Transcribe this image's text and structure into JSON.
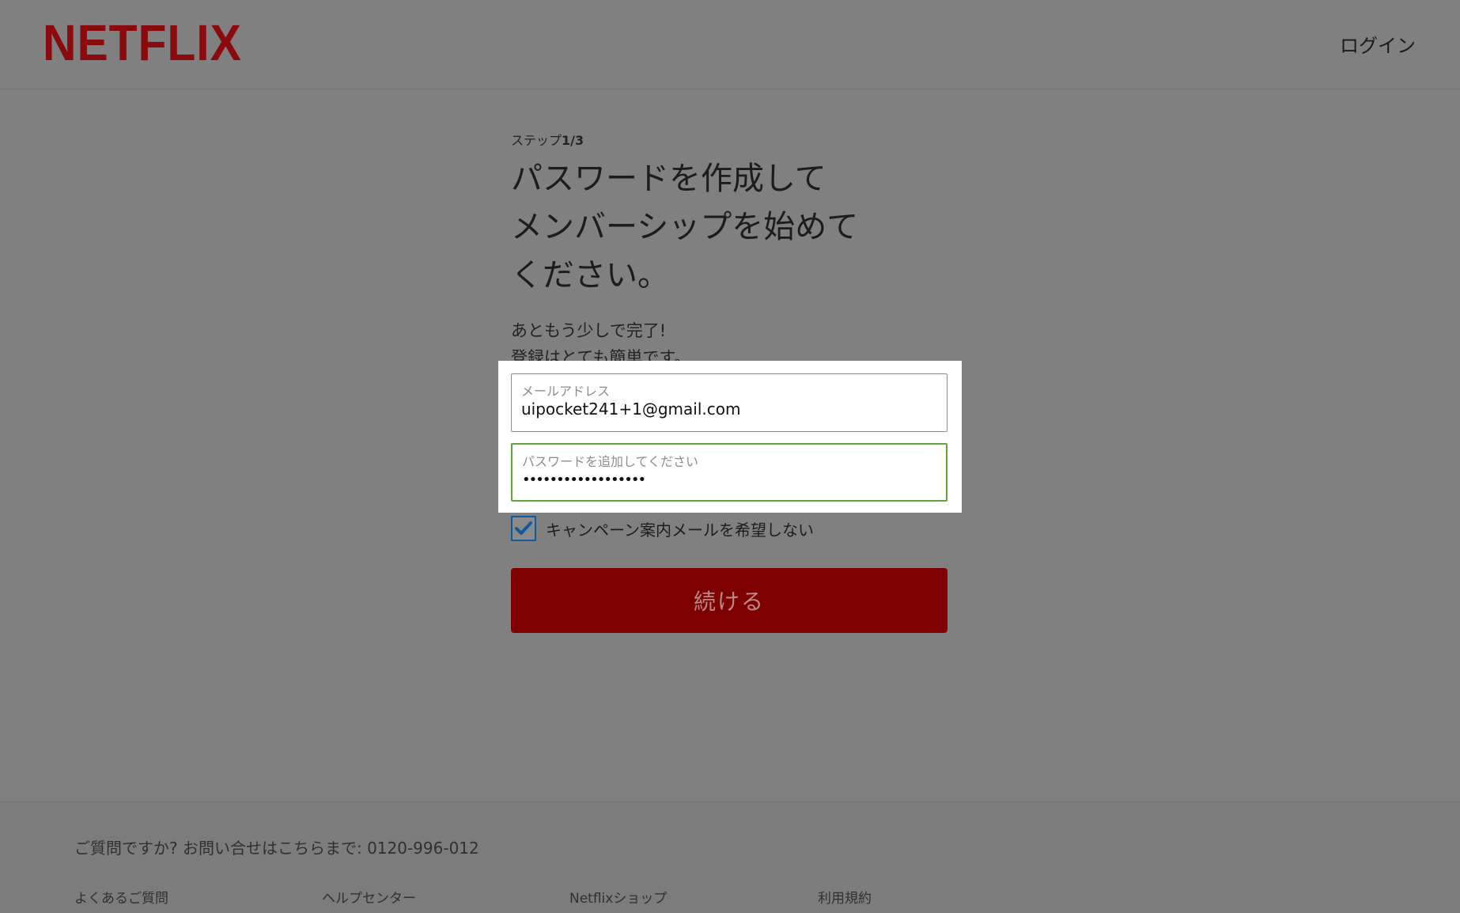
{
  "header": {
    "logo_text": "NETFLIX",
    "login_label": "ログイン"
  },
  "main": {
    "step_prefix": "ステップ",
    "step_value": "1/3",
    "title_lines": [
      "パスワードを作成して",
      "メンバーシップを始めて",
      "ください。"
    ],
    "subtitle_lines": [
      "あともう少しで完了!",
      "登録はとても簡単です。"
    ]
  },
  "form": {
    "email_label": "メールアドレス",
    "email_value": "uipocket241+1@gmail.com",
    "password_label": "パスワードを追加してください",
    "password_value": "••••••••••••••••••",
    "optout_label": "キャンペーン案内メールを希望しない",
    "optout_checked": true,
    "continue_label": "続ける"
  },
  "footer": {
    "contact_text": "ご質問ですか? お問い合せはこちらまで: 0120-996-012",
    "links": [
      "よくあるご質問",
      "ヘルプセンター",
      "Netflixショップ",
      "利用規約"
    ]
  },
  "colors": {
    "brand": "#8a0a0e",
    "button": "#7f0000",
    "valid_border": "#5fa53c",
    "checkbox_border": "#0f5aa0"
  }
}
